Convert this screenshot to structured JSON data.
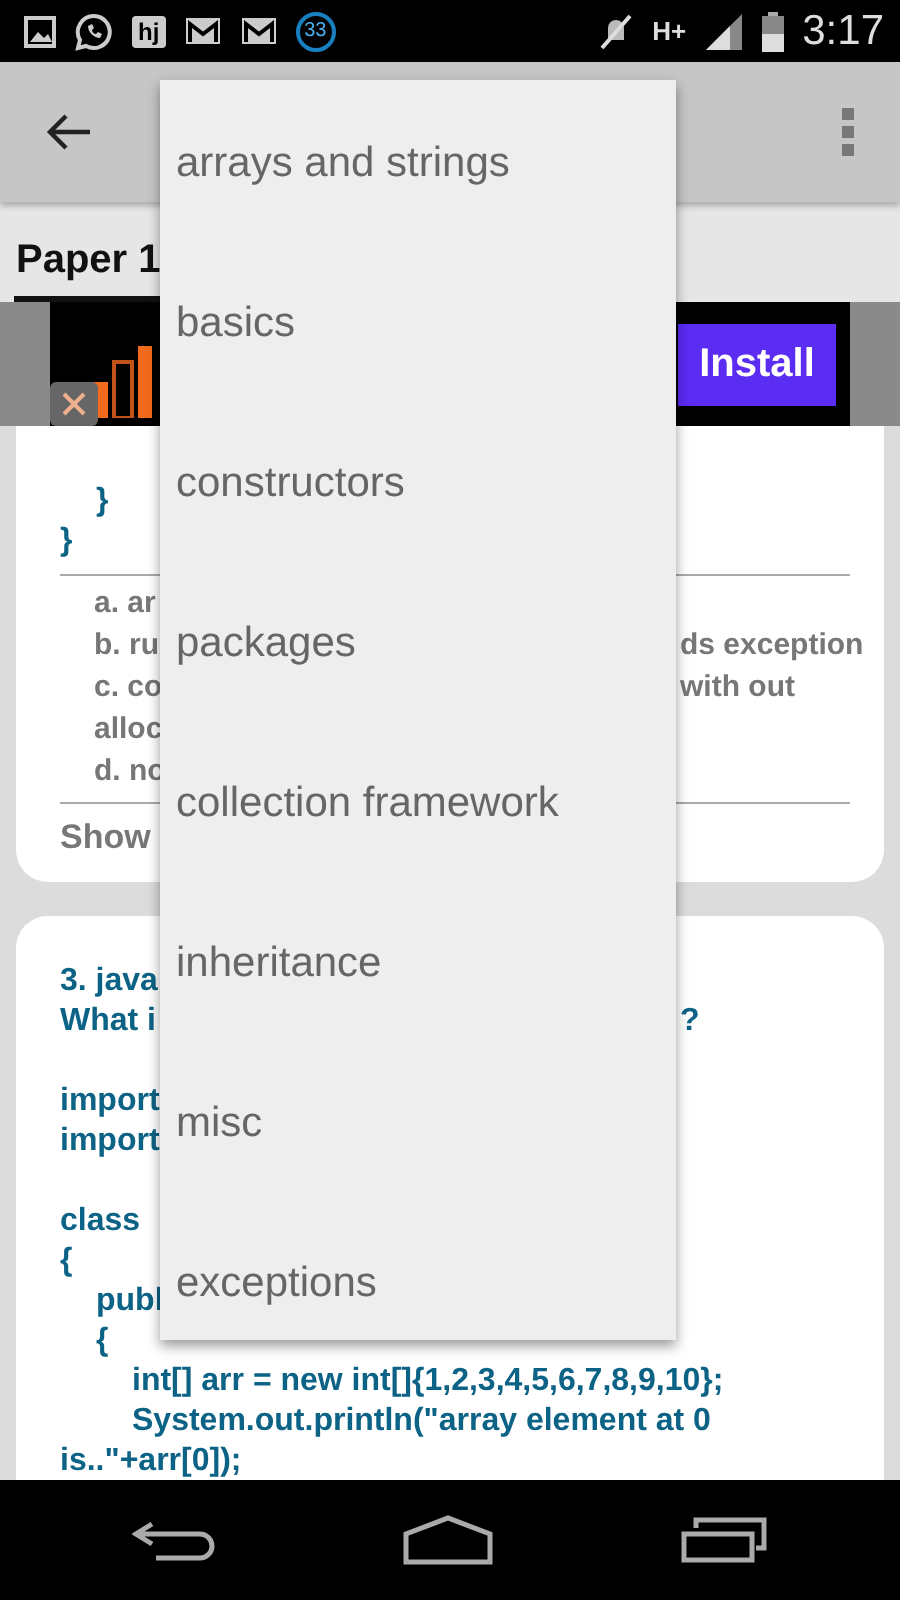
{
  "status_bar": {
    "app_badge": "hj",
    "notification_count": "33",
    "network": "H+",
    "time": "3:17"
  },
  "tabs": [
    {
      "label": "Paper 1",
      "selected": true
    }
  ],
  "ad": {
    "button": "Install"
  },
  "cards": [
    {
      "code_lines": [
        {
          "text": "}"
        },
        {
          "text": "}"
        }
      ],
      "options": [
        {
          "text": "a. ar"
        },
        {
          "text": "b. ru",
          "right": "ds exception"
        },
        {
          "text": "c. co",
          "right": "with out"
        },
        {
          "text": "alloc"
        },
        {
          "text": "d. no"
        }
      ],
      "footer": "Show"
    },
    {
      "code_lines": [
        {
          "text": "3. java"
        },
        {
          "text": "What i",
          "right": "?"
        },
        {
          "text": "import"
        },
        {
          "text": "import"
        },
        {
          "text": "class"
        },
        {
          "text": "{"
        },
        {
          "text": "publ"
        },
        {
          "text": "{"
        },
        {
          "text": "int[] arr = new int[]{1,2,3,4,5,6,7,8,9,10};"
        },
        {
          "text": "System.out.println(\"array element at 0"
        },
        {
          "text": "is..\"+arr[0]);"
        }
      ]
    }
  ],
  "dropdown": {
    "items": [
      {
        "label": "arrays and strings"
      },
      {
        "label": "basics"
      },
      {
        "label": "constructors"
      },
      {
        "label": "packages"
      },
      {
        "label": "collection framework"
      },
      {
        "label": "inheritance"
      },
      {
        "label": "misc"
      },
      {
        "label": "exceptions"
      }
    ]
  }
}
